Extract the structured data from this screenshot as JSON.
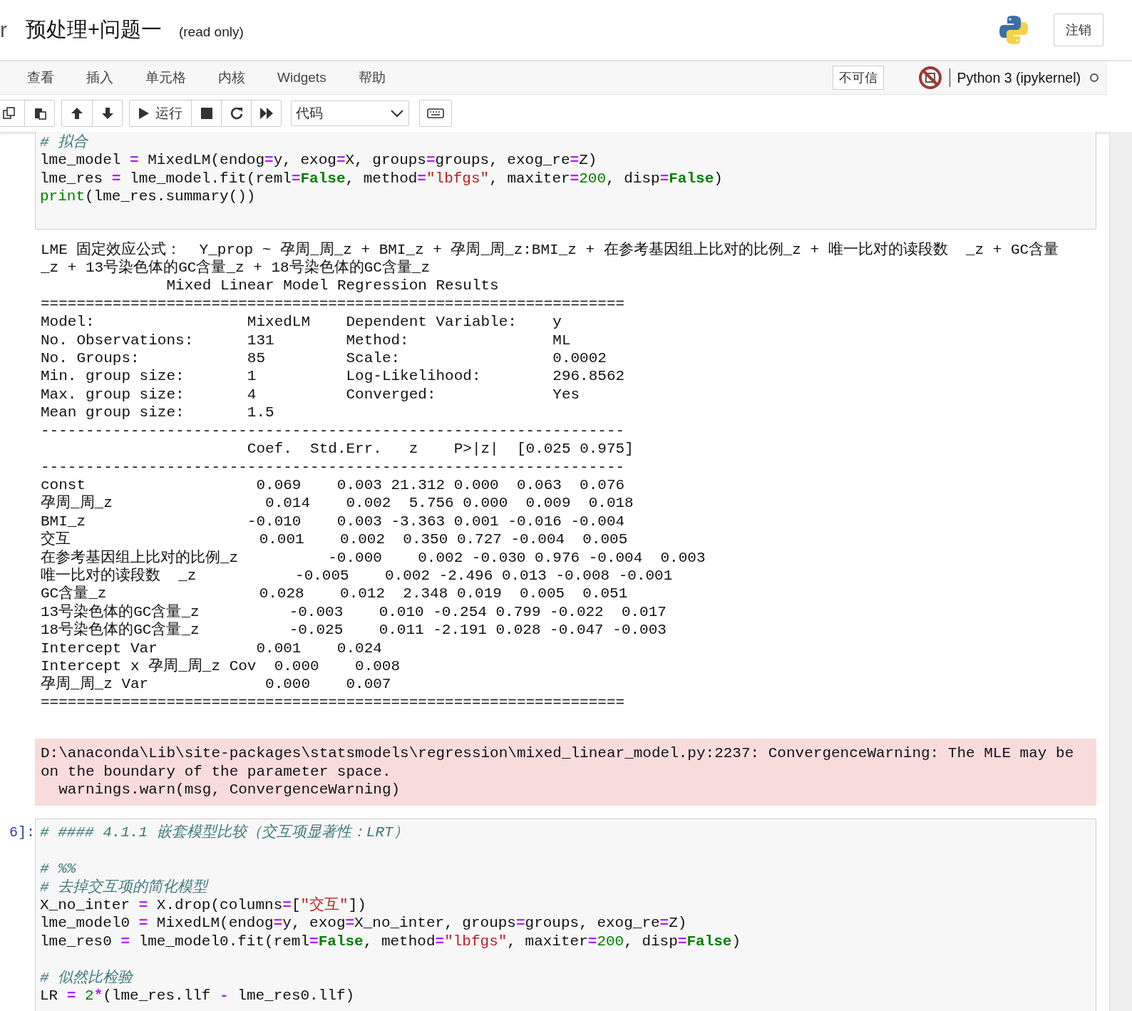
{
  "header": {
    "logo_fragment": "r",
    "title": "预处理+问题一",
    "status": "(read only)",
    "logout": "注销"
  },
  "menu": [
    "查看",
    "插入",
    "单元格",
    "内核",
    "Widgets",
    "帮助"
  ],
  "kernel": {
    "trust": "不可信",
    "name": "Python 3 (ipykernel)",
    "busy": false
  },
  "toolbar": {
    "run": "运行",
    "cell_type": "代码"
  },
  "cell1": {
    "lines": [
      {
        "tokens": [
          {
            "kind": "comment",
            "text": "# 拟合"
          }
        ]
      },
      {
        "tokens": [
          {
            "kind": "name",
            "text": "lme_model "
          },
          {
            "kind": "op",
            "text": "="
          },
          {
            "kind": "name",
            "text": " MixedLM(endog"
          },
          {
            "kind": "op",
            "text": "="
          },
          {
            "kind": "name",
            "text": "y, exog"
          },
          {
            "kind": "op",
            "text": "="
          },
          {
            "kind": "name",
            "text": "X, groups"
          },
          {
            "kind": "op",
            "text": "="
          },
          {
            "kind": "name",
            "text": "groups, exog_re"
          },
          {
            "kind": "op",
            "text": "="
          },
          {
            "kind": "name",
            "text": "Z)"
          }
        ]
      },
      {
        "tokens": [
          {
            "kind": "name",
            "text": "lme_res "
          },
          {
            "kind": "op",
            "text": "="
          },
          {
            "kind": "name",
            "text": " lme_model.fit(reml"
          },
          {
            "kind": "op",
            "text": "="
          },
          {
            "kind": "keyword",
            "text": "False"
          },
          {
            "kind": "name",
            "text": ", method"
          },
          {
            "kind": "op",
            "text": "="
          },
          {
            "kind": "string",
            "text": "\"lbfgs\""
          },
          {
            "kind": "name",
            "text": ", maxiter"
          },
          {
            "kind": "op",
            "text": "="
          },
          {
            "kind": "number",
            "text": "200"
          },
          {
            "kind": "name",
            "text": ", disp"
          },
          {
            "kind": "op",
            "text": "="
          },
          {
            "kind": "keyword",
            "text": "False"
          },
          {
            "kind": "name",
            "text": ")"
          }
        ]
      },
      {
        "tokens": [
          {
            "kind": "builtin",
            "text": "print"
          },
          {
            "kind": "name",
            "text": "(lme_res.summary())"
          }
        ]
      }
    ],
    "output": [
      "LME 固定效应公式：  Y_prop ~ 孕周_周_z + BMI_z + 孕周_周_z:BMI_z + 在参考基因组上比对的比例_z + 唯一比对的读段数  _z + GC含量_z + 13号染色体的GC含量_z + 18号染色体的GC含量_z",
      "              Mixed Linear Model Regression Results",
      "=================================================================",
      "Model:                 MixedLM    Dependent Variable:    y",
      "No. Observations:      131        Method:                ML",
      "No. Groups:            85         Scale:                 0.0002",
      "Min. group size:       1          Log-Likelihood:        296.8562",
      "Max. group size:       4          Converged:             Yes",
      "Mean group size:       1.5",
      "-----------------------------------------------------------------",
      "                       Coef.  Std.Err.   z    P>|z|  [0.025 0.975]",
      "-----------------------------------------------------------------",
      "const                   0.069    0.003 21.312 0.000  0.063  0.076",
      "孕周_周_z                 0.014    0.002  5.756 0.000  0.009  0.018",
      "BMI_z                  -0.010    0.003 -3.363 0.001 -0.016 -0.004",
      "交互                     0.001    0.002  0.350 0.727 -0.004  0.005",
      "在参考基因组上比对的比例_z          -0.000    0.002 -0.030 0.976 -0.004  0.003",
      "唯一比对的读段数  _z           -0.005    0.002 -2.496 0.013 -0.008 -0.001",
      "GC含量_z                 0.028    0.012  2.348 0.019  0.005  0.051",
      "13号染色体的GC含量_z          -0.003    0.010 -0.254 0.799 -0.022  0.017",
      "18号染色体的GC含量_z          -0.025    0.011 -2.191 0.028 -0.047 -0.003",
      "Intercept Var           0.001    0.024",
      "Intercept x 孕周_周_z Cov  0.000    0.008",
      "孕周_周_z Var             0.000    0.007",
      "================================================================="
    ],
    "warning": [
      "D:\\anaconda\\Lib\\site-packages\\statsmodels\\regression\\mixed_linear_model.py:2237: ConvergenceWarning: The MLE may be on the boundary of the parameter space.",
      "  warnings.warn(msg, ConvergenceWarning)"
    ]
  },
  "cell2": {
    "prompt": "6]:",
    "lines": [
      {
        "tokens": [
          {
            "kind": "comment",
            "text": "# #### 4.1.1 嵌套模型比较（交互项显著性：LRT）"
          }
        ]
      },
      {
        "space_before": true,
        "tokens": [
          {
            "kind": "comment",
            "text": "# %%"
          }
        ]
      },
      {
        "tokens": [
          {
            "kind": "comment",
            "text": "# 去掉交互项的简化模型"
          }
        ]
      },
      {
        "tokens": [
          {
            "kind": "name",
            "text": "X_no_inter "
          },
          {
            "kind": "op",
            "text": "="
          },
          {
            "kind": "name",
            "text": " X.drop(columns"
          },
          {
            "kind": "op",
            "text": "="
          },
          {
            "kind": "name",
            "text": "["
          },
          {
            "kind": "string",
            "text": "\"交互\""
          },
          {
            "kind": "name",
            "text": "])"
          }
        ]
      },
      {
        "tokens": [
          {
            "kind": "name",
            "text": "lme_model0 "
          },
          {
            "kind": "op",
            "text": "="
          },
          {
            "kind": "name",
            "text": " MixedLM(endog"
          },
          {
            "kind": "op",
            "text": "="
          },
          {
            "kind": "name",
            "text": "y, exog"
          },
          {
            "kind": "op",
            "text": "="
          },
          {
            "kind": "name",
            "text": "X_no_inter, groups"
          },
          {
            "kind": "op",
            "text": "="
          },
          {
            "kind": "name",
            "text": "groups, exog_re"
          },
          {
            "kind": "op",
            "text": "="
          },
          {
            "kind": "name",
            "text": "Z)"
          }
        ]
      },
      {
        "tokens": [
          {
            "kind": "name",
            "text": "lme_res0 "
          },
          {
            "kind": "op",
            "text": "="
          },
          {
            "kind": "name",
            "text": " lme_model0.fit(reml"
          },
          {
            "kind": "op",
            "text": "="
          },
          {
            "kind": "keyword",
            "text": "False"
          },
          {
            "kind": "name",
            "text": ", method"
          },
          {
            "kind": "op",
            "text": "="
          },
          {
            "kind": "string",
            "text": "\"lbfgs\""
          },
          {
            "kind": "name",
            "text": ", maxiter"
          },
          {
            "kind": "op",
            "text": "="
          },
          {
            "kind": "number",
            "text": "200"
          },
          {
            "kind": "name",
            "text": ", disp"
          },
          {
            "kind": "op",
            "text": "="
          },
          {
            "kind": "keyword",
            "text": "False"
          },
          {
            "kind": "name",
            "text": ")"
          }
        ]
      },
      {
        "space_before": true,
        "tokens": [
          {
            "kind": "comment",
            "text": "# 似然比检验"
          }
        ]
      },
      {
        "tokens": [
          {
            "kind": "name",
            "text": "LR "
          },
          {
            "kind": "op",
            "text": "="
          },
          {
            "kind": "number",
            "text": " 2"
          },
          {
            "kind": "op",
            "text": "*"
          },
          {
            "kind": "name",
            "text": "(lme_res.llf "
          },
          {
            "kind": "op",
            "text": "-"
          },
          {
            "kind": "name",
            "text": " lme_res0.llf)"
          }
        ]
      }
    ]
  }
}
